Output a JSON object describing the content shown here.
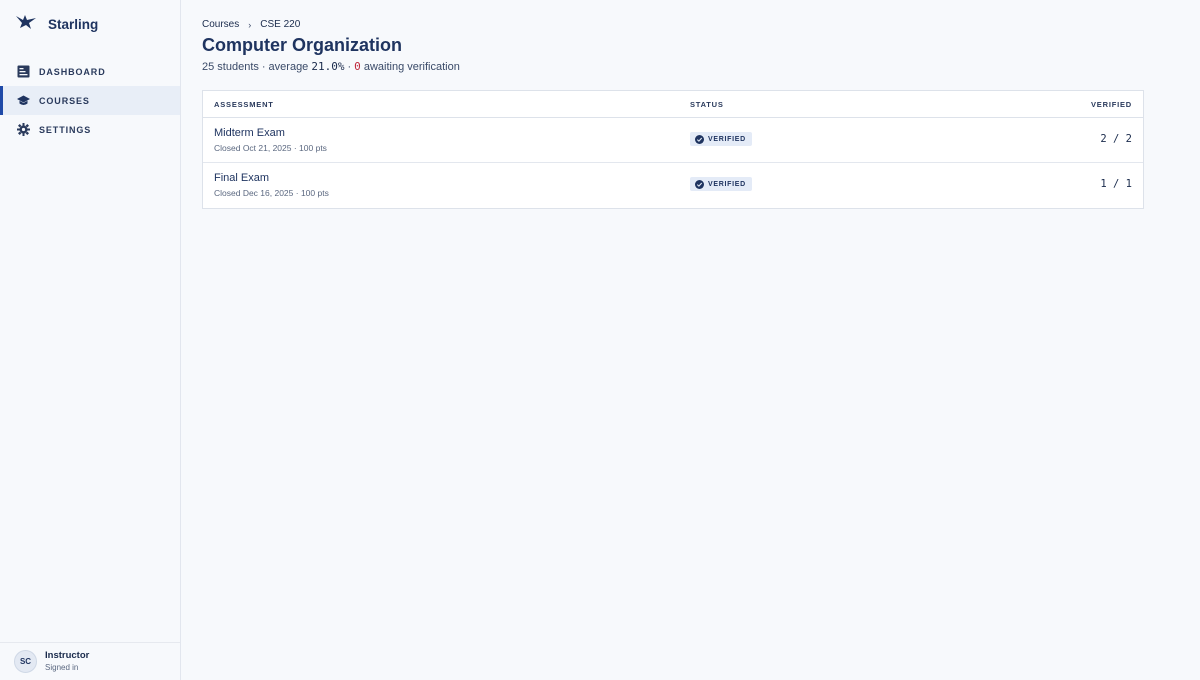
{
  "app": {
    "name": "Starling",
    "logo_icon": "bird-logo-icon"
  },
  "sidebar": {
    "items": [
      {
        "label": "DASHBOARD",
        "icon": "dashboard-icon",
        "active": false
      },
      {
        "label": "COURSES",
        "icon": "graduation-cap-icon",
        "active": true
      },
      {
        "label": "SETTINGS",
        "icon": "gear-icon",
        "active": false
      }
    ],
    "user": {
      "initials": "SC",
      "role": "Instructor",
      "status": "Signed in"
    }
  },
  "breadcrumb": {
    "root": "Courses",
    "current": "CSE 220"
  },
  "page": {
    "title": "Computer Organization",
    "summary": {
      "students": "25 students",
      "average_label": "average",
      "average_value": "21.0%",
      "awaiting_count": "0",
      "awaiting_label": "awaiting verification"
    }
  },
  "table": {
    "columns": [
      "ASSESSMENT",
      "STATUS",
      "VERIFIED"
    ],
    "rows": [
      {
        "title": "Midterm Exam",
        "meta": "Closed Oct 21, 2025 · 100 pts",
        "status": "VERIFIED",
        "verified": "2 / 2"
      },
      {
        "title": "Final Exam",
        "meta": "Closed Dec 16, 2025 · 100 pts",
        "status": "VERIFIED",
        "verified": "1 / 1"
      }
    ]
  },
  "colors": {
    "accent": "#1f4aa8",
    "alert": "#c0283c",
    "badge_bg": "#e4ebf7"
  }
}
